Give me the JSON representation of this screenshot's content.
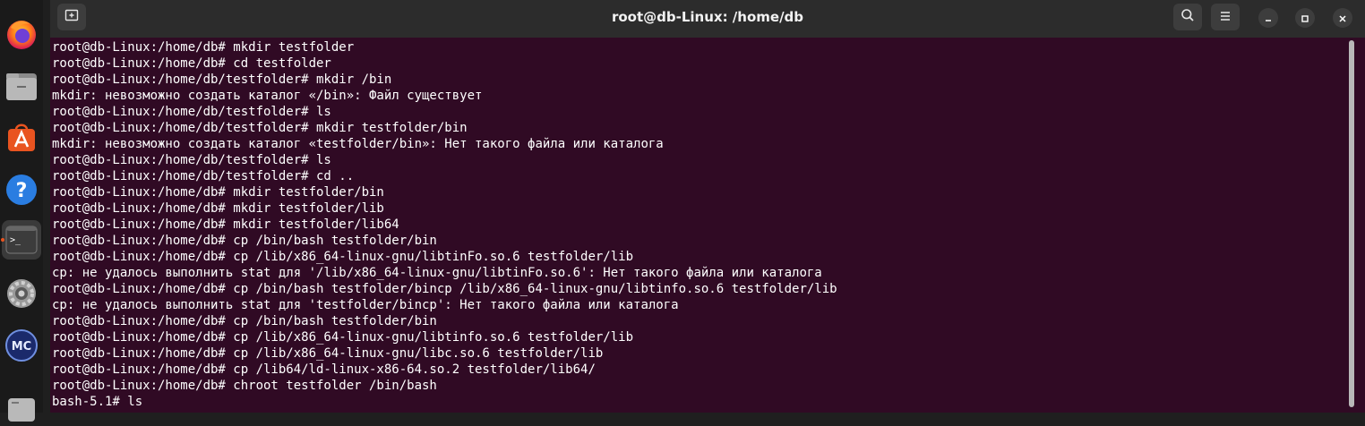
{
  "dock": {
    "items": [
      {
        "name": "firefox",
        "icon": "firefox-icon"
      },
      {
        "name": "files",
        "icon": "files-icon"
      },
      {
        "name": "app-center",
        "icon": "app-center-icon"
      },
      {
        "name": "help",
        "icon": "help-icon",
        "glyph": "?"
      },
      {
        "name": "terminal",
        "icon": "terminal-icon",
        "glyph": ">_",
        "active": true
      },
      {
        "name": "settings",
        "icon": "settings-icon"
      },
      {
        "name": "midnight-commander",
        "icon": "midnight-commander-icon",
        "glyph": "MC"
      },
      {
        "name": "apps-grid",
        "icon": "apps-grid-icon"
      }
    ]
  },
  "window": {
    "title": "root@db-Linux: /home/db",
    "new_tab_icon": "new-tab-icon",
    "search_icon": "search-icon",
    "menu_icon": "hamburger-menu-icon",
    "minimize_icon": "minimize-icon",
    "maximize_icon": "maximize-icon",
    "close_icon": "close-icon"
  },
  "colors": {
    "terminal_bg": "#300a24",
    "terminal_fg": "#ffffff",
    "titlebar_bg": "#2c2c2c",
    "dock_bg": "#1a1a1a",
    "accent": "#e95420"
  },
  "terminal": {
    "lines": [
      "root@db-Linux:/home/db# mkdir testfolder",
      "root@db-Linux:/home/db# cd testfolder",
      "root@db-Linux:/home/db/testfolder# mkdir /bin",
      "mkdir: невозможно создать каталог «/bin»: Файл существует",
      "root@db-Linux:/home/db/testfolder# ls",
      "root@db-Linux:/home/db/testfolder# mkdir testfolder/bin",
      "mkdir: невозможно создать каталог «testfolder/bin»: Нет такого файла или каталога",
      "root@db-Linux:/home/db/testfolder# ls",
      "root@db-Linux:/home/db/testfolder# cd ..",
      "root@db-Linux:/home/db# mkdir testfolder/bin",
      "root@db-Linux:/home/db# mkdir testfolder/lib",
      "root@db-Linux:/home/db# mkdir testfolder/lib64",
      "root@db-Linux:/home/db# cp /bin/bash testfolder/bin",
      "root@db-Linux:/home/db# cp /lib/x86_64-linux-gnu/libtinFo.so.6 testfolder/lib",
      "cp: не удалось выполнить stat для '/lib/x86_64-linux-gnu/libtinFo.so.6': Нет такого файла или каталога",
      "root@db-Linux:/home/db# cp /bin/bash testfolder/bincp /lib/x86_64-linux-gnu/libtinfo.so.6 testfolder/lib",
      "cp: не удалось выполнить stat для 'testfolder/bincp': Нет такого файла или каталога",
      "root@db-Linux:/home/db# cp /bin/bash testfolder/bin",
      "root@db-Linux:/home/db# cp /lib/x86_64-linux-gnu/libtinfo.so.6 testfolder/lib",
      "root@db-Linux:/home/db# cp /lib/x86_64-linux-gnu/libc.so.6 testfolder/lib",
      "root@db-Linux:/home/db# cp /lib64/ld-linux-x86-64.so.2 testfolder/lib64/",
      "root@db-Linux:/home/db# chroot testfolder /bin/bash",
      "bash-5.1# ls"
    ]
  }
}
